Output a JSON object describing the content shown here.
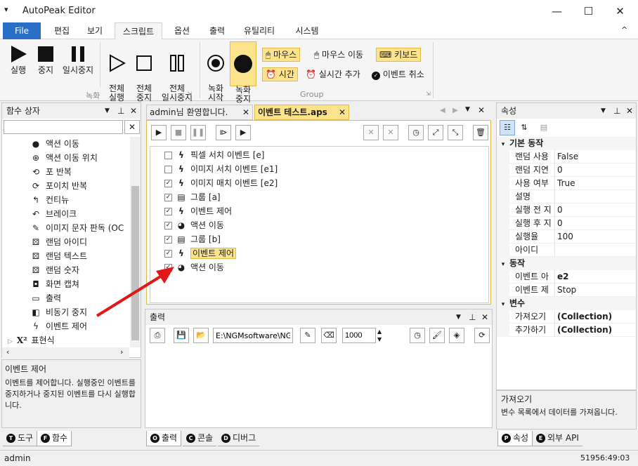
{
  "window": {
    "title": "AutoPeak Editor",
    "minimize": "—",
    "maximize": "☐",
    "close": "✕",
    "sysmenu": "▾"
  },
  "menu": {
    "file": "File",
    "tabs": [
      "편집",
      "보기",
      "스크립트",
      "옵션",
      "출력",
      "유틸리티",
      "시스템"
    ],
    "active": "스크립트",
    "collapse": "^"
  },
  "ribbon": {
    "record_group": {
      "label": "녹화",
      "buttons": [
        {
          "label": "실행"
        },
        {
          "label": "중지"
        },
        {
          "label": "일시중지"
        },
        {
          "label": "전체\n실행"
        },
        {
          "label": "전체\n중지"
        },
        {
          "label": "전체\n일시중지"
        }
      ]
    },
    "group_group": {
      "label": "Group",
      "start": "녹화\n시작",
      "stop": "녹화\n중지",
      "mouse": "마우스",
      "mouse_move": "마우스 이동",
      "keyboard": "키보드",
      "time": "시간",
      "realtime_add": "실시간 추가",
      "event_cancel": "이벤트 취소"
    }
  },
  "left_panel": {
    "title": "함수 상자",
    "search_value": "",
    "items": [
      {
        "label": "액션 이동",
        "icon": "action-icon"
      },
      {
        "label": "액션 이동 위치",
        "icon": "target-icon"
      },
      {
        "label": "포 반복",
        "icon": "loop-icon"
      },
      {
        "label": "포이치 반복",
        "icon": "loop2-icon"
      },
      {
        "label": "컨티뉴",
        "icon": "continue-icon"
      },
      {
        "label": "브레이크",
        "icon": "break-icon"
      },
      {
        "label": "이미지 문자 판독 (OC",
        "icon": "ocr-icon"
      },
      {
        "label": "랜덤 아이디",
        "icon": "dice-icon"
      },
      {
        "label": "랜덤 텍스트",
        "icon": "dice-icon"
      },
      {
        "label": "랜덤 숫자",
        "icon": "dice-icon"
      },
      {
        "label": "화면 캡쳐",
        "icon": "camera-icon"
      },
      {
        "label": "출력",
        "icon": "console-icon"
      },
      {
        "label": "비동기 중지",
        "icon": "async-icon"
      },
      {
        "label": "이벤트 제어",
        "icon": "bolt-icon"
      }
    ],
    "category": "표현식",
    "desc_title": "이벤트 제어",
    "desc_text": "이벤트를 제어합니다. 실행중인 이벤트를 중지하거나 중지된 이벤트를 다시 실행합니다.",
    "tabs": [
      {
        "key": "T",
        "label": "도구"
      },
      {
        "key": "F",
        "label": "함수"
      }
    ]
  },
  "doc_tabs": [
    {
      "label": "admin님 환영합니다."
    },
    {
      "label": "이벤트 테스트.aps"
    }
  ],
  "script_tree": [
    {
      "label": "픽셀 서치 이벤트 [e]",
      "checked": false,
      "icon": "bolt"
    },
    {
      "label": "이미지 서치 이벤트 [e1]",
      "checked": false,
      "icon": "bolt"
    },
    {
      "label": "이미지 매치 이벤트 [e2]",
      "checked": true,
      "icon": "bolt"
    },
    {
      "label": "그룹 [a]",
      "checked": true,
      "icon": "group"
    },
    {
      "label": "이벤트 제어",
      "checked": true,
      "icon": "bolt"
    },
    {
      "label": "액션 이동",
      "checked": true,
      "icon": "action"
    },
    {
      "label": "그룹 [b]",
      "checked": true,
      "icon": "group"
    },
    {
      "label": "이벤트 제어",
      "checked": true,
      "icon": "bolt",
      "selected": true
    },
    {
      "label": "액션 이동",
      "checked": true,
      "icon": "action"
    }
  ],
  "output": {
    "title": "출력",
    "path": "E:\\NGMsoftware\\NG",
    "count": "1000",
    "tabs": [
      {
        "key": "O",
        "label": "출력"
      },
      {
        "key": "C",
        "label": "콘솔"
      },
      {
        "key": "D",
        "label": "디버그"
      }
    ]
  },
  "properties": {
    "title": "속성",
    "sections": [
      {
        "name": "기본 동작",
        "rows": [
          {
            "k": "랜덤 사용",
            "v": "False"
          },
          {
            "k": "랜덤 지연",
            "v": "0"
          },
          {
            "k": "사용 여부",
            "v": "True"
          },
          {
            "k": "설명",
            "v": ""
          },
          {
            "k": "실행 전 지",
            "v": "0"
          },
          {
            "k": "실행 후 지",
            "v": "0"
          },
          {
            "k": "실행율",
            "v": "100"
          },
          {
            "k": "아이디",
            "v": ""
          }
        ]
      },
      {
        "name": "동작",
        "rows": [
          {
            "k": "이벤트 아",
            "v": "e2"
          },
          {
            "k": "이벤트 제",
            "v": "Stop"
          }
        ]
      },
      {
        "name": "변수",
        "rows": [
          {
            "k": "가져오기",
            "v": "(Collection)"
          },
          {
            "k": "추가하기",
            "v": "(Collection)"
          }
        ]
      }
    ],
    "desc_title": "가져오기",
    "desc_text": "변수 목록에서 데이터를 가져옵니다.",
    "tabs": [
      {
        "key": "P",
        "label": "속성"
      },
      {
        "key": "E",
        "label": "외부 API"
      }
    ]
  },
  "status": {
    "user": "admin",
    "time": "51956:49:03"
  }
}
